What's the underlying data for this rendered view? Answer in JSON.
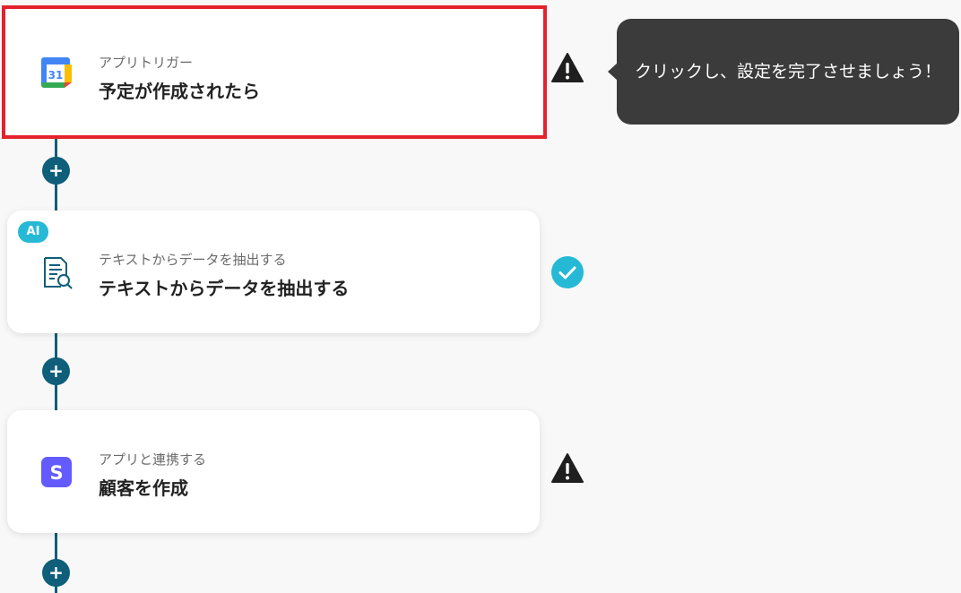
{
  "steps": [
    {
      "subtitle": "アプリトリガー",
      "title": "予定が作成されたら",
      "icon": "google-calendar-icon",
      "calendar_day": "31",
      "status": "warning"
    },
    {
      "badge": "AI",
      "subtitle": "テキストからデータを抽出する",
      "title": "テキストからデータを抽出する",
      "icon": "document-search-icon",
      "status": "done"
    },
    {
      "subtitle": "アプリと連携する",
      "title": "顧客を作成",
      "icon": "stripe-icon",
      "icon_letter": "S",
      "status": "warning"
    }
  ],
  "add_button_symbol": "+",
  "tooltip": {
    "text": "クリックし、設定を完了させましょう！"
  },
  "colors": {
    "connector": "#0f5e7a",
    "selection": "#e3222d",
    "ai_badge": "#26b9d6",
    "done": "#26b9d6",
    "warning": "#1f1f1f",
    "tooltip_bg": "#3b3b3b",
    "stripe": "#635bff"
  }
}
